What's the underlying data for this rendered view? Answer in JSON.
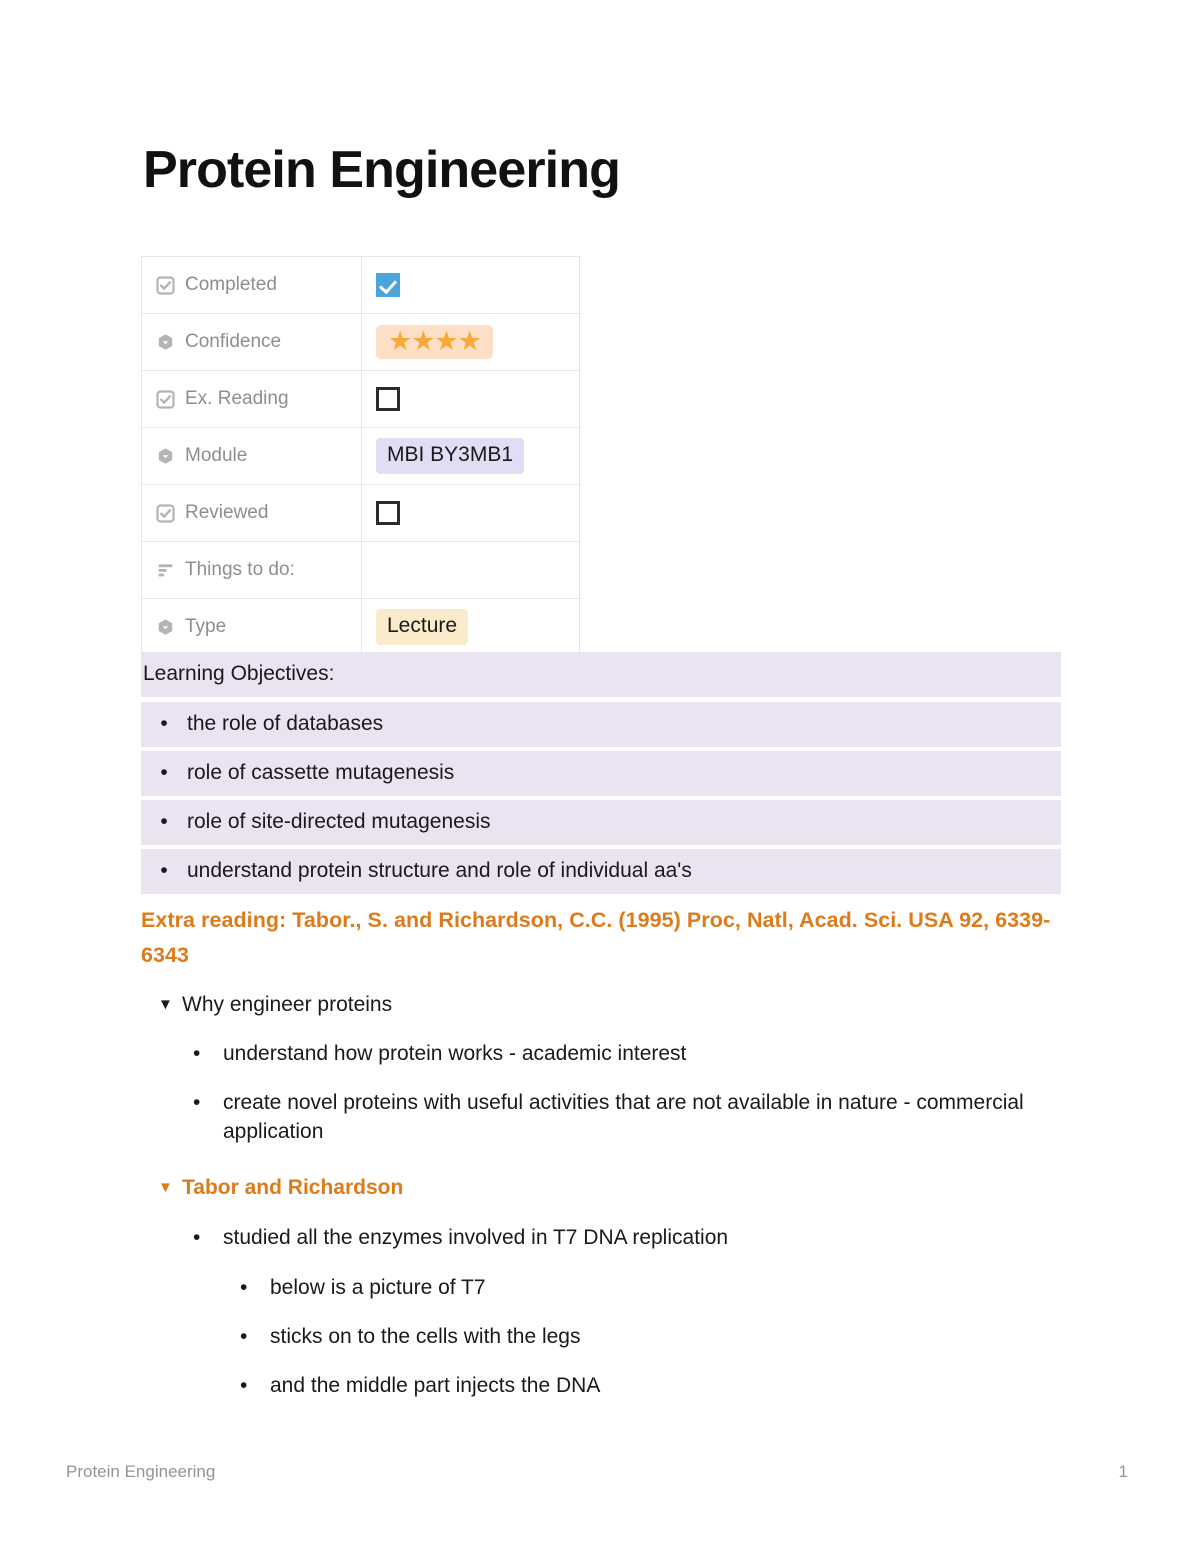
{
  "document": {
    "title": "Protein Engineering"
  },
  "properties": {
    "rows": [
      {
        "icon": "checkbox-icon",
        "label": "Completed",
        "value_type": "checkbox",
        "checked": true,
        "value": ""
      },
      {
        "icon": "select-icon",
        "label": "Confidence",
        "value_type": "stars",
        "stars": 4,
        "value": "★★★★"
      },
      {
        "icon": "checkbox-icon",
        "label": "Ex. Reading",
        "value_type": "checkbox",
        "checked": false,
        "value": ""
      },
      {
        "icon": "select-icon",
        "label": "Module",
        "value_type": "pill",
        "value": "MBI BY3MB1"
      },
      {
        "icon": "checkbox-icon",
        "label": "Reviewed",
        "value_type": "checkbox",
        "checked": false,
        "value": ""
      },
      {
        "icon": "text-lines-icon",
        "label": "Things to do:",
        "value_type": "empty",
        "value": ""
      },
      {
        "icon": "select-icon",
        "label": "Type",
        "value_type": "pill",
        "value": "Lecture"
      }
    ]
  },
  "learning_objectives": {
    "heading": "Learning Objectives:",
    "bullet_glyph": "•",
    "items": [
      "the role of databases",
      "role of cassette mutagenesis",
      "role of site-directed mutagenesis",
      "understand protein structure and role of individual aa's"
    ]
  },
  "extra_reading": {
    "text": "Extra reading: Tabor., S. and Richardson, C.C. (1995) Proc, Natl, Acad. Sci. USA 92, 6339-6343"
  },
  "outline": {
    "toggle_glyph": "▼",
    "bullet_glyph": "•",
    "sections": [
      {
        "heading": "Why engineer proteins",
        "accent": false,
        "items": [
          "understand how protein works - academic interest",
          "create novel proteins with useful activities that are not available in nature - commercial application"
        ]
      },
      {
        "heading": "Tabor and Richardson",
        "accent": true,
        "items": [
          "studied all the enzymes involved in T7 DNA replication"
        ],
        "subitems": [
          "below is a picture of T7",
          "sticks on to the cells with the legs",
          "and the middle part injects the DNA"
        ]
      }
    ]
  },
  "footer": {
    "left": "Protein Engineering",
    "page_number": "1"
  },
  "colors": {
    "accent_orange": "#dd7b1b",
    "star_orange": "#f9a93a",
    "star_bg": "#fcdfc5",
    "module_bg": "#e3dcf5",
    "type_bg": "#faecca",
    "highlight_bg": "#e9e3f2",
    "checkbox_blue": "#4aa3da",
    "table_border": "#e6e6e6",
    "key_text": "#8e8e8e",
    "footer_text": "#949494"
  }
}
